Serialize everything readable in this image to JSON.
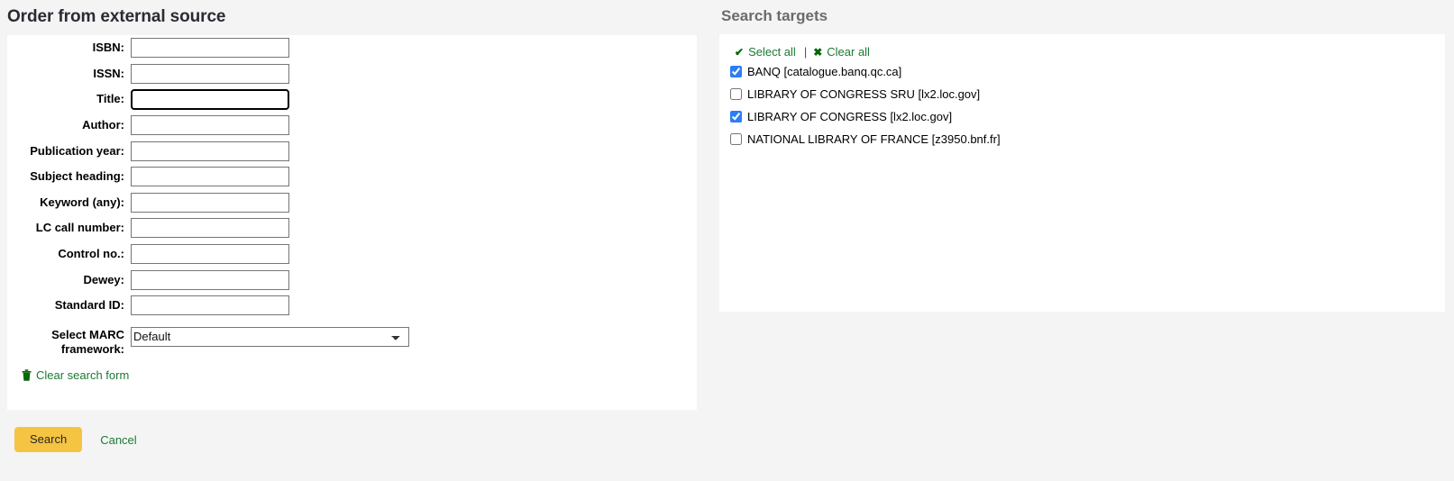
{
  "page": {
    "title": "Order from external source"
  },
  "search_form": {
    "fields": [
      {
        "label": "ISBN:",
        "name": "isbn",
        "value": "",
        "focused": false
      },
      {
        "label": "ISSN:",
        "name": "issn",
        "value": "",
        "focused": false
      },
      {
        "label": "Title:",
        "name": "title",
        "value": "",
        "focused": true
      },
      {
        "label": "Author:",
        "name": "author",
        "value": "",
        "focused": false
      },
      {
        "label": "Publication year:",
        "name": "publication-year",
        "value": "",
        "focused": false
      },
      {
        "label": "Subject heading:",
        "name": "subject-heading",
        "value": "",
        "focused": false
      },
      {
        "label": "Keyword (any):",
        "name": "keyword-any",
        "value": "",
        "focused": false
      },
      {
        "label": "LC call number:",
        "name": "lc-call-number",
        "value": "",
        "focused": false
      },
      {
        "label": "Control no.:",
        "name": "control-no",
        "value": "",
        "focused": false
      },
      {
        "label": "Dewey:",
        "name": "dewey",
        "value": "",
        "focused": false
      },
      {
        "label": "Standard ID:",
        "name": "standard-id",
        "value": "",
        "focused": false
      }
    ],
    "marc_framework": {
      "label": "Select MARC framework:",
      "selected": "Default",
      "options": [
        "Default"
      ]
    },
    "clear_link": {
      "label": "Clear search form",
      "icon": "trash-icon"
    }
  },
  "actions": {
    "search_label": "Search",
    "cancel_label": "Cancel"
  },
  "search_targets": {
    "title": "Search targets",
    "toolbar": {
      "select_all_label": "Select all",
      "select_all_icon": "check-icon",
      "separator": "|",
      "clear_all_label": "Clear all",
      "clear_all_icon": "cross-icon"
    },
    "items": [
      {
        "label": "BANQ [catalogue.banq.qc.ca]",
        "checked": true
      },
      {
        "label": "LIBRARY OF CONGRESS SRU [lx2.loc.gov]",
        "checked": false
      },
      {
        "label": "LIBRARY OF CONGRESS [lx2.loc.gov]",
        "checked": true
      },
      {
        "label": "NATIONAL LIBRARY OF FRANCE [z3950.bnf.fr]",
        "checked": false
      }
    ]
  },
  "colors": {
    "page_background": "#f4f4f4",
    "panel_background": "#ffffff",
    "heading_dark": "#2b2b33",
    "heading_gray": "#6b6b6b",
    "link_green": "#1a7a33",
    "icon_green": "#046604",
    "button_amber": "#f5c443",
    "checkbox_blue": "#2b7ef5"
  }
}
